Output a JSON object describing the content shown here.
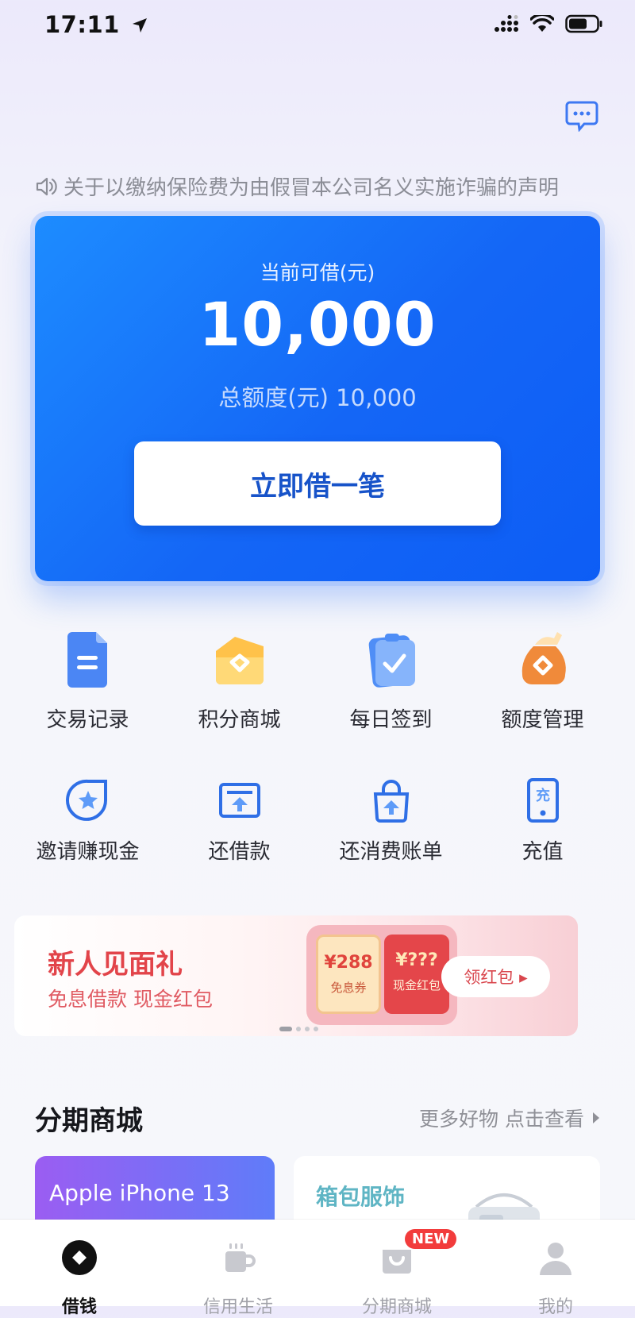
{
  "status_bar": {
    "time": "17:11"
  },
  "notice": {
    "text": "关于以缴纳保险费为由假冒本公司名义实施诈骗的声明"
  },
  "loan_card": {
    "label": "当前可借(元)",
    "amount": "10,000",
    "total_line": "总额度(元) 10,000",
    "borrow_button": "立即借一笔"
  },
  "quick_actions": [
    {
      "label": "交易记录",
      "icon": "document-icon"
    },
    {
      "label": "积分商城",
      "icon": "points-shop-icon"
    },
    {
      "label": "每日签到",
      "icon": "checkin-icon"
    },
    {
      "label": "额度管理",
      "icon": "credit-bag-icon"
    }
  ],
  "services": [
    {
      "label": "邀请赚现金",
      "icon": "invite-star-icon"
    },
    {
      "label": "还借款",
      "icon": "repay-card-icon"
    },
    {
      "label": "还消费账单",
      "icon": "shopping-bag-icon"
    },
    {
      "label": "充值",
      "icon": "recharge-icon"
    }
  ],
  "promo": {
    "title": "新人见面礼",
    "subtitle": "免息借款 现金红包",
    "coupon1_amount": "¥288",
    "coupon1_label": "免息券",
    "coupon2_amount": "¥???",
    "coupon2_label": "现金红包",
    "button": "领红包 ▸"
  },
  "mall": {
    "title": "分期商城",
    "more": "更多好物 点击查看",
    "products": [
      {
        "name": "Apple iPhone 13"
      },
      {
        "name": "箱包服饰"
      }
    ]
  },
  "tabbar": {
    "tabs": [
      {
        "label": "借钱"
      },
      {
        "label": "信用生活"
      },
      {
        "label": "分期商城",
        "badge": "NEW"
      },
      {
        "label": "我的"
      }
    ]
  },
  "colors": {
    "accent": "#1466f6",
    "promo_red": "#e2444a"
  }
}
